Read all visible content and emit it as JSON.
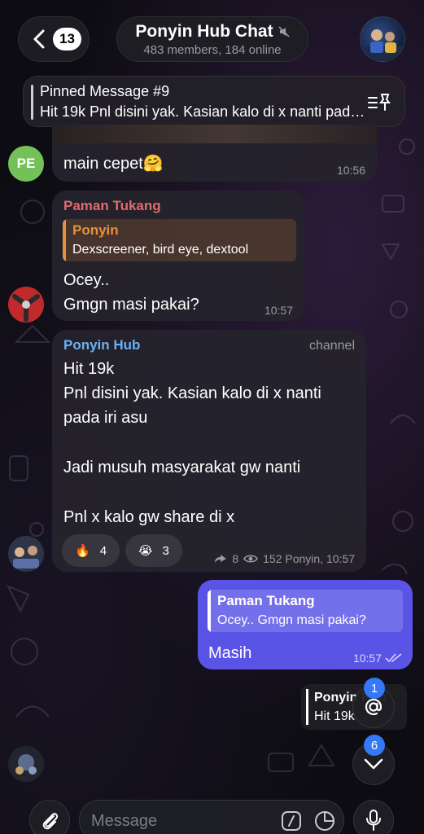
{
  "header": {
    "back_count": "13",
    "title": "Ponyin Hub Chat",
    "subtitle": "483 members, 184 online"
  },
  "pinned": {
    "title": "Pinned Message #9",
    "text": "Hit 19k Pnl disini yak. Kasian kalo di x nanti pada iri asu"
  },
  "messages": {
    "m1": {
      "avatar_initials": "PE",
      "text": "main cepet🤗",
      "time": "10:56"
    },
    "m2": {
      "sender": "Paman Tukang",
      "reply_name": "Ponyin",
      "reply_text": "Dexscreener, bird eye, dextool",
      "line1": "Ocey..",
      "line2": "Gmgn masi pakai?",
      "time": "10:57"
    },
    "m3": {
      "sender": "Ponyin Hub",
      "tag": "channel",
      "lines": [
        "Hit 19k",
        "Pnl disini yak. Kasian kalo di x nanti",
        "pada iri asu",
        "",
        "Jadi musuh masyarakat gw nanti",
        "",
        "Pnl x kalo gw share di x"
      ],
      "reactions": [
        {
          "emoji": "🔥",
          "count": "4"
        },
        {
          "emoji": "😭",
          "count": "3"
        }
      ],
      "forwards": "8",
      "views_meta": "152 Ponyin, 10:57"
    },
    "m4": {
      "reply_name": "Paman Tukang",
      "reply_text": "Ocey.. Gmgn masi pakai?",
      "text": "Masih",
      "time": "10:57"
    },
    "m5": {
      "preview_name": "Ponyin Hub",
      "preview_text": "Hit 19k"
    }
  },
  "floating": {
    "mention_count": "1",
    "scroll_count": "6"
  },
  "input": {
    "placeholder": "Message"
  },
  "colors": {
    "accent": "#5a54e6",
    "paman_name": "#e06b6b",
    "ponyin_name": "#e8903a",
    "hub_name": "#6ab3f3",
    "badge_blue": "#3478f6"
  }
}
